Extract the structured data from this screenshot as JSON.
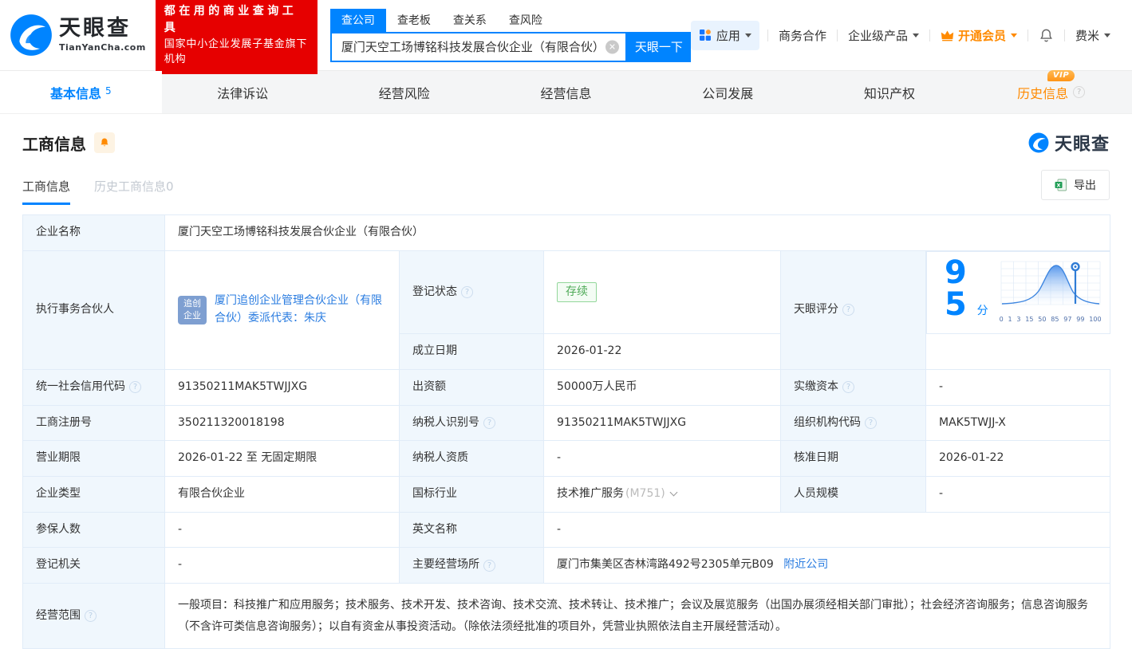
{
  "header": {
    "logo": {
      "brand": "天眼查",
      "domain": "TianYanCha.com"
    },
    "slogan_line1": "都在用的商业查询工具",
    "slogan_line2": "国家中小企业发展子基金旗下机构",
    "search": {
      "tabs": [
        {
          "label": "查公司"
        },
        {
          "label": "查老板"
        },
        {
          "label": "查关系"
        },
        {
          "label": "查风险"
        }
      ],
      "value": "厦门天空工场博铭科技发展合伙企业（有限合伙）",
      "button": "天眼一下"
    },
    "menu": {
      "apps": "应用",
      "cooperation": "商务合作",
      "enterprise": "企业级产品",
      "vip": "开通会员",
      "user": "费米"
    }
  },
  "nav": {
    "tabs": [
      {
        "label": "基本信息",
        "count": "5"
      },
      {
        "label": "法律诉讼"
      },
      {
        "label": "经营风险"
      },
      {
        "label": "经营信息"
      },
      {
        "label": "公司发展"
      },
      {
        "label": "知识产权"
      },
      {
        "label": "历史信息",
        "vip_badge": "VIP"
      }
    ]
  },
  "section": {
    "title": "工商信息",
    "subtab_active": "工商信息",
    "subtab_history": "历史工商信息0",
    "export": "导出",
    "watermark": "天眼查"
  },
  "fields": {
    "company_name": {
      "label": "企业名称",
      "value": "厦门天空工场博铭科技发展合伙企业（有限合伙）"
    },
    "managing_partner": {
      "label": "执行事务合伙人",
      "badge_line1": "追创",
      "badge_line2": "企业",
      "value": "厦门追创企业管理合伙企业（有限合伙）委派代表：朱庆"
    },
    "reg_status": {
      "label": "登记状态",
      "value": "存续"
    },
    "establish_date": {
      "label": "成立日期",
      "value": "2026-01-22"
    },
    "tianyan_score": {
      "label": "天眼评分",
      "value": "95",
      "unit": "分",
      "ticks": [
        "0",
        "1",
        "3",
        "15",
        "50",
        "85",
        "97",
        "99",
        "100"
      ]
    },
    "credit_code": {
      "label": "统一社会信用代码",
      "value": "91350211MAK5TWJJXG"
    },
    "capital": {
      "label": "出资额",
      "value": "50000万人民币"
    },
    "paid_capital": {
      "label": "实缴资本",
      "value": "-"
    },
    "reg_number": {
      "label": "工商注册号",
      "value": "350211320018198"
    },
    "taxpayer_id": {
      "label": "纳税人识别号",
      "value": "91350211MAK5TWJJXG"
    },
    "org_code": {
      "label": "组织机构代码",
      "value": "MAK5TWJJ-X"
    },
    "business_term": {
      "label": "营业期限",
      "value": "2026-01-22 至 无固定期限"
    },
    "taxpayer_quality": {
      "label": "纳税人资质",
      "value": "-"
    },
    "approval_date": {
      "label": "核准日期",
      "value": "2026-01-22"
    },
    "company_type": {
      "label": "企业类型",
      "value": "有限合伙企业"
    },
    "industry": {
      "label": "国标行业",
      "value": "技术推广服务",
      "code": "(M751)"
    },
    "staff_size": {
      "label": "人员规模",
      "value": "-"
    },
    "insured_count": {
      "label": "参保人数",
      "value": "-"
    },
    "english_name": {
      "label": "英文名称",
      "value": "-"
    },
    "reg_authority": {
      "label": "登记机关",
      "value": "-"
    },
    "premises": {
      "label": "主要经营场所",
      "value": "厦门市集美区杏林湾路492号2305单元B09",
      "link": "附近公司"
    },
    "business_scope": {
      "label": "经营范围",
      "value": "一般项目：科技推广和应用服务；技术服务、技术开发、技术咨询、技术交流、技术转让、技术推广；会议及展览服务（出国办展须经相关部门审批）；社会经济咨询服务；信息咨询服务（不含许可类信息咨询服务）；以自有资金从事投资活动。（除依法须经批准的项目外，凭营业执照依法自主开展经营活动）。"
    }
  },
  "colors": {
    "brand_blue": "#0084ff",
    "link_blue": "#2a7ce0",
    "orange": "#ff8a00",
    "red": "#e60000",
    "green": "#4eaa57"
  }
}
